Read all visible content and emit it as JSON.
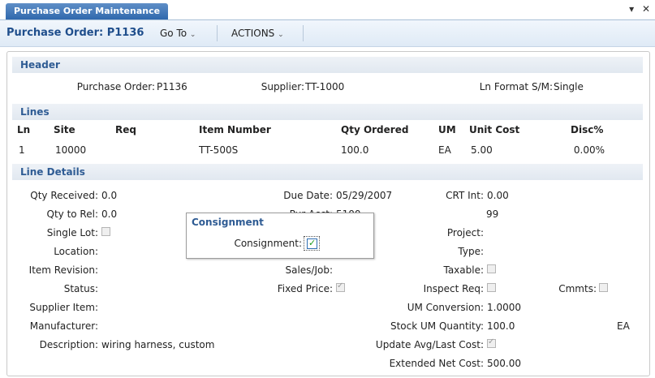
{
  "tab": {
    "label": "Purchase Order Maintenance"
  },
  "window_controls": {
    "dropdown": "▾",
    "close": "✕"
  },
  "toolbar": {
    "title": "Purchase Order: P1136",
    "goto_label": "Go To",
    "actions_label": "ACTIONS",
    "chevron": "⌄"
  },
  "header": {
    "section_title": "Header",
    "purchase_order_label": "Purchase Order:",
    "purchase_order": "P1136",
    "supplier_label": "Supplier:",
    "supplier": "TT-1000",
    "ln_format_label": "Ln Format S/M:",
    "ln_format": "Single"
  },
  "lines": {
    "section_title": "Lines",
    "columns": {
      "ln": "Ln",
      "site": "Site",
      "req": "Req",
      "item": "Item Number",
      "qty": "Qty Ordered",
      "um": "UM",
      "cost": "Unit Cost",
      "disc": "Disc%"
    },
    "row": {
      "ln": "1",
      "site": "10000",
      "req": "",
      "item": "TT-500S",
      "qty": "100.0",
      "um": "EA",
      "cost": "5.00",
      "disc": "0.00%"
    }
  },
  "line_details": {
    "section_title": "Line Details",
    "qty_received_label": "Qty Received:",
    "qty_received": "0.0",
    "qty_to_rel_label": "Qty to Rel:",
    "qty_to_rel": "0.0",
    "single_lot_label": "Single Lot:",
    "location_label": "Location:",
    "item_revision_label": "Item Revision:",
    "status_label": "Status:",
    "supplier_item_label": "Supplier Item:",
    "manufacturer_label": "Manufacturer:",
    "description_label": "Description:",
    "description": "wiring harness, custom",
    "due_date_label": "Due Date:",
    "due_date": "05/29/2007",
    "crt_int_label": "CRT Int:",
    "crt_int": "0.00",
    "pur_acct_label": "Pur Acct:",
    "pur_acct": "5100",
    "pur_acct_sub": "99",
    "project_label": "Project:",
    "type_label": "Type:",
    "sales_job_label": "Sales/Job:",
    "taxable_label": "Taxable:",
    "fixed_price_label": "Fixed Price:",
    "fixed_price_checked": true,
    "inspect_req_label": "Inspect Req:",
    "cmmts_label": "Cmmts:",
    "um_conversion_label": "UM Conversion:",
    "um_conversion": "1.0000",
    "stock_um_qty_label": "Stock UM Quantity:",
    "stock_um_qty": "100.0",
    "stock_um": "EA",
    "update_avg_label": "Update Avg/Last Cost:",
    "update_avg_checked": true,
    "ext_net_cost_label": "Extended Net Cost:",
    "ext_net_cost": "500.00"
  },
  "consignment_popup": {
    "title": "Consignment",
    "label": "Consignment:",
    "checked": true
  }
}
